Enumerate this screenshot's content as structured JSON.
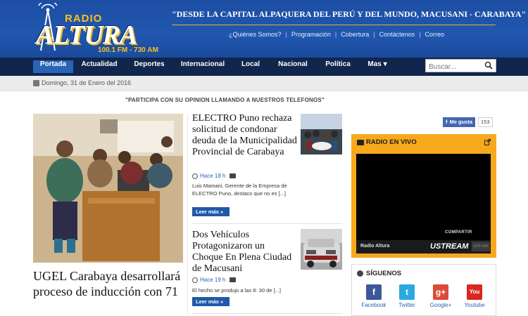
{
  "logo": {
    "radio": "RADIO",
    "altura": "ALTURA",
    "freq": "100.1 FM - 730 AM"
  },
  "tagline": "\"DESDE LA CAPITAL ALPAQUERA DEL PERÚ Y DEL MUNDO, MACUSANI - CARABAYA\"",
  "top_links": [
    "¿Quiénes Somos?",
    "Programación",
    "Cobertura",
    "Contáctenos",
    "Correo"
  ],
  "nav": {
    "items": [
      "Portada",
      "Actualidad",
      "Deportes",
      "Internacional",
      "Local",
      "Nacional",
      "Política",
      "Mas ▾"
    ],
    "active": "Portada",
    "search_placeholder": "Buscar..."
  },
  "date": "Domingo, 31 de Enero del 2016",
  "participa": "\"PARTICIPA CON SU OPINION LLAMANDO A NUESTROS TELEFONOS\"",
  "feature": {
    "title": "UGEL Carabaya desarrollará proceso de inducción con 71"
  },
  "articles": [
    {
      "title": "ELECTRO Puno rechaza solicitud de condonar deuda de la Municipalidad Provincial de Carabaya",
      "time": "Hace 18 h",
      "excerpt": "Luis Mamani, Gerente de la Empresa de ELECTRO Puno, destaco que no es [...]",
      "more": "Leer más »"
    },
    {
      "title": "Dos Vehículos Protagonizaron un Choque En Plena Ciudad de Macusani",
      "time": "Hace 19 h",
      "excerpt": "El hecho se produjo a las 8: 30 de [...]",
      "more": "Leer más »"
    }
  ],
  "sidebar": {
    "like_label": "Me gusta",
    "like_count": "153",
    "radio_title": "RADIO EN VIVO",
    "player_share": "COMPARTIR",
    "player_name": "Radio Altura",
    "player_brand": "USTREAM",
    "player_status": "OFF AIR",
    "follow_title": "SÍGUENOS",
    "social": [
      {
        "name": "Facebook",
        "icon": "facebook-icon",
        "color": "#3b5998",
        "glyph": "f"
      },
      {
        "name": "Twitter",
        "icon": "twitter-icon",
        "color": "#2aa9e0",
        "glyph": "t"
      },
      {
        "name": "Google+",
        "icon": "googleplus-icon",
        "color": "#dc4a38",
        "glyph": "g+"
      },
      {
        "name": "Youtube",
        "icon": "youtube-icon",
        "color": "#d8281f",
        "glyph": "You"
      }
    ]
  }
}
